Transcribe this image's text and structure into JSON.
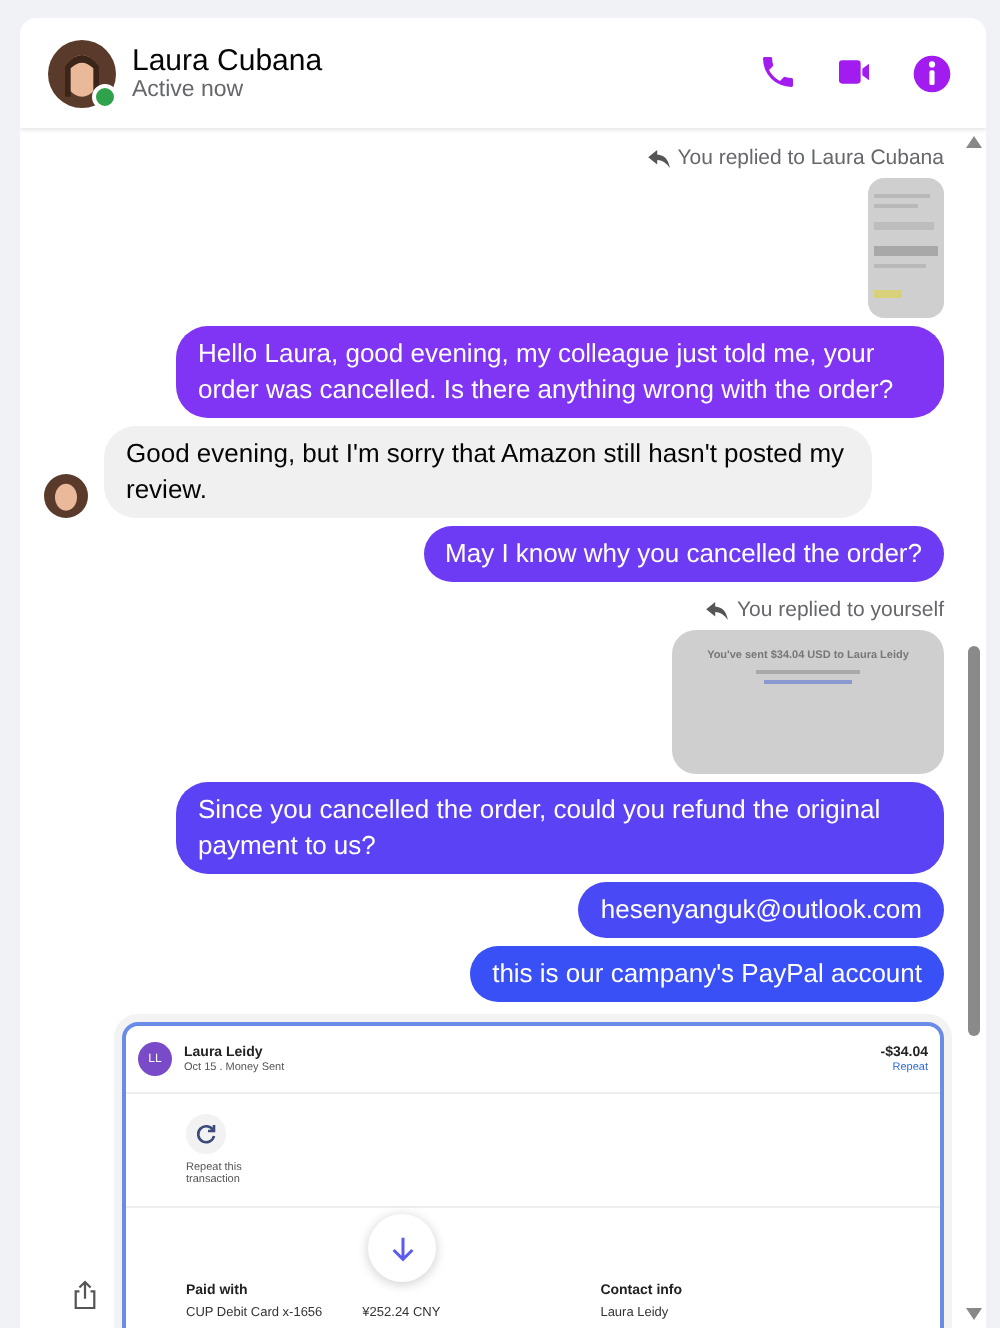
{
  "header": {
    "name": "Laura Cubana",
    "status": "Active now",
    "online": true
  },
  "messages": [
    {
      "kind": "reply_note",
      "text": "You replied to Laura Cubana"
    },
    {
      "kind": "thumb_small"
    },
    {
      "kind": "outgoing",
      "text": "Hello Laura, good evening, my colleague just told me, your order was cancelled. Is there anything wrong with the order?"
    },
    {
      "kind": "incoming",
      "text": "Good evening, but I'm sorry that Amazon still hasn't posted my review."
    },
    {
      "kind": "outgoing",
      "text": "May I know why you cancelled the order?"
    },
    {
      "kind": "reply_note",
      "text": "You replied to yourself"
    },
    {
      "kind": "thumb_receipt",
      "text": "You've sent $34.04 USD to Laura Leidy"
    },
    {
      "kind": "outgoing",
      "text": "Since you cancelled the order, could you refund the original payment to us?"
    },
    {
      "kind": "outgoing",
      "text": "hesenyanguk@outlook.com"
    },
    {
      "kind": "outgoing",
      "text": "this is our campany's PayPal account"
    },
    {
      "kind": "receipt",
      "initials": "LL",
      "name": "Laura Leidy",
      "meta": "Oct 15 . Money Sent",
      "amount": "-$34.04",
      "repeat": "Repeat",
      "repeat_action": "Repeat this transaction",
      "paid_heading": "Paid with",
      "card": "CUP Debit Card x-1656",
      "card_amount": "¥252.24 CNY",
      "contact_heading": "Contact info",
      "contact_name": "Laura Leidy"
    }
  ]
}
